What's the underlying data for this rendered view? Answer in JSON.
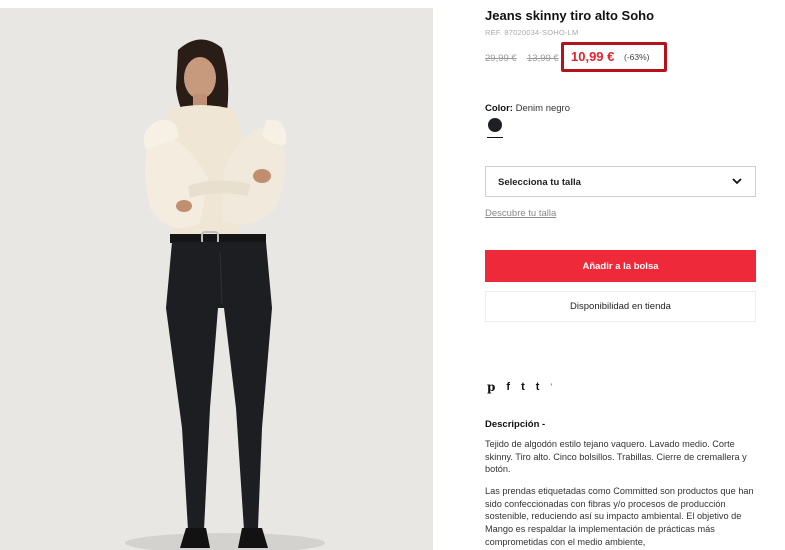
{
  "product": {
    "title": "Jeans skinny tiro alto Soho",
    "ref": "REF. 87020034-SOHO-LM",
    "old_price_1": "29,99 €",
    "old_price_2": "13,99 €",
    "sale_price": "10,99 €",
    "discount": "(-63%)",
    "color_label": "Color:",
    "color_value": "Denim negro",
    "swatch_color": "#1e1f23"
  },
  "size": {
    "select_label": "Selecciona tu talla",
    "guide_link": "Descubre tu talla"
  },
  "actions": {
    "add_to_bag": "Añadir a la bolsa",
    "store_availability": "Disponibilidad en tienda"
  },
  "social": {
    "icons": [
      "pinterest-icon",
      "facebook-icon",
      "twitter-icon",
      "tumblr-icon"
    ],
    "pinterest": "p",
    "facebook": "f",
    "twitter": "t",
    "tumblr": "t",
    "more": "'"
  },
  "description": {
    "title": "Descripción -",
    "paragraph_1": "Tejido de algodón estilo tejano vaquero. Lavado medio. Corte skinny. Tiro alto. Cinco bolsillos. Trabillas. Cierre de cremallera y botón.",
    "paragraph_2": "Las prendas etiquetadas como Committed son productos que han sido confeccionadas con fibras y/o procesos de producción sostenible, reduciendo así su impacto ambiental. El objetivo de Mango es respaldar la implementación de prácticas más comprometidas con el medio ambiente,"
  },
  "colors": {
    "accent_red": "#ee2a3a",
    "highlight_border": "#b5121b",
    "sale_red": "#e0242d"
  }
}
